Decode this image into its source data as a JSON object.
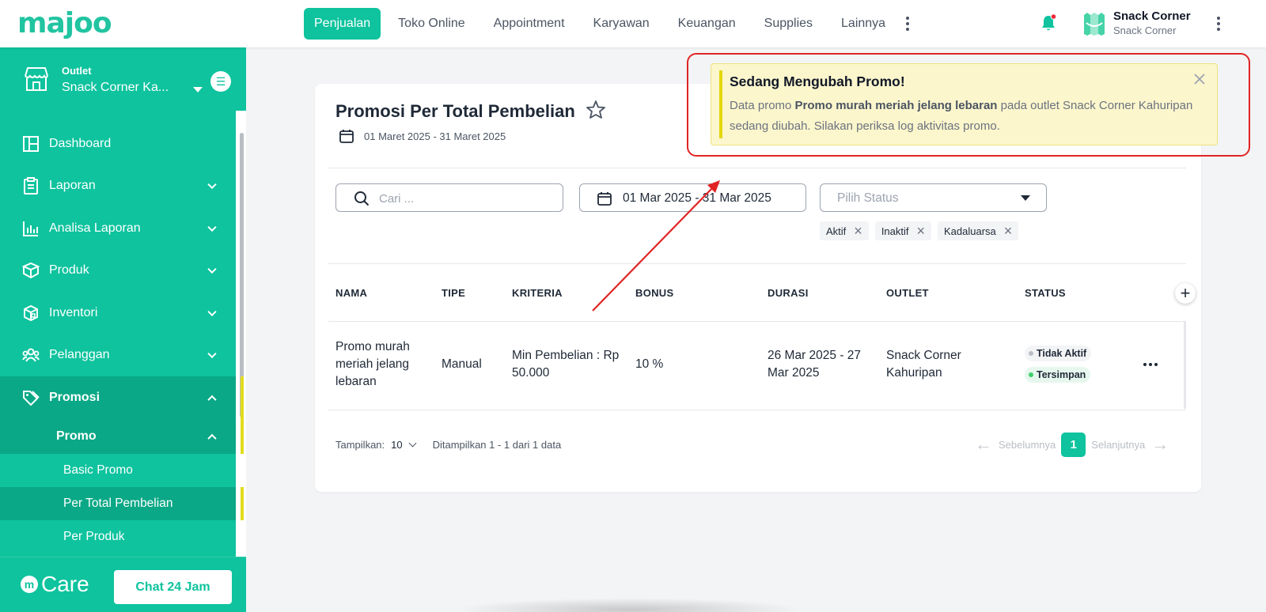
{
  "brand": {
    "logo_text": "majoo"
  },
  "nav": {
    "items": [
      {
        "label": "Penjualan",
        "active": true
      },
      {
        "label": "Toko Online"
      },
      {
        "label": "Appointment"
      },
      {
        "label": "Karyawan"
      },
      {
        "label": "Keuangan"
      },
      {
        "label": "Supplies"
      },
      {
        "label": "Lainnya"
      }
    ]
  },
  "user": {
    "name": "Snack Corner",
    "subtitle": "Snack Corner"
  },
  "sidebar": {
    "outlet_label": "Outlet",
    "outlet_name": "Snack Corner Ka...",
    "items": [
      {
        "label": "Dashboard",
        "icon": "dashboard-icon"
      },
      {
        "label": "Laporan",
        "icon": "clipboard-icon"
      },
      {
        "label": "Analisa Laporan",
        "icon": "bar-chart-icon"
      },
      {
        "label": "Produk",
        "icon": "box-icon"
      },
      {
        "label": "Inventori",
        "icon": "cube-icon"
      },
      {
        "label": "Pelanggan",
        "icon": "users-icon"
      },
      {
        "label": "Promosi",
        "icon": "tag-icon"
      }
    ],
    "submenu_label": "Promo",
    "subitems": [
      {
        "label": "Basic Promo"
      },
      {
        "label": "Per Total Pembelian",
        "active": true
      },
      {
        "label": "Per Produk"
      }
    ],
    "care_label": "Care",
    "care_m": "m",
    "chat_button": "Chat 24 Jam"
  },
  "page": {
    "title": "Promosi Per Total Pembelian",
    "date_range": "01 Maret 2025 - 31 Maret 2025"
  },
  "filters": {
    "search_placeholder": "Cari ...",
    "date_value": "01 Mar 2025 - 31 Mar 2025",
    "status_placeholder": "Pilih Status",
    "chips": [
      "Aktif",
      "Inaktif",
      "Kadaluarsa"
    ]
  },
  "table": {
    "headers": [
      "NAMA",
      "TIPE",
      "KRITERIA",
      "BONUS",
      "DURASI",
      "OUTLET",
      "STATUS"
    ],
    "rows": [
      {
        "nama": "Promo murah meriah jelang lebaran",
        "tipe": "Manual",
        "kriteria": "Min Pembelian : Rp 50.000",
        "bonus": "10 %",
        "durasi": "26 Mar 2025 - 27 Mar 2025",
        "outlet": "Snack Corner Kahuripan",
        "status_1": "Tidak Aktif",
        "status_2": "Tersimpan"
      }
    ]
  },
  "pagination": {
    "show_label": "Tampilkan:",
    "per_page": "10",
    "info": "Ditampilkan 1 - 1 dari 1 data",
    "prev": "Sebelumnya",
    "current": "1",
    "next": "Selanjutnya"
  },
  "toast": {
    "title": "Sedang Mengubah Promo!",
    "body_prefix": "Data promo ",
    "body_bold": "Promo murah meriah jelang lebaran",
    "body_suffix": " pada outlet Snack Corner Kahuripan sedang diubah. Silakan periksa log aktivitas promo."
  },
  "colors": {
    "brand": "#0ec39e",
    "brand_dark": "#0aa886",
    "toast_bg": "#fcf6cc",
    "toast_accent": "#e3d70d",
    "highlight": "#e02424"
  }
}
